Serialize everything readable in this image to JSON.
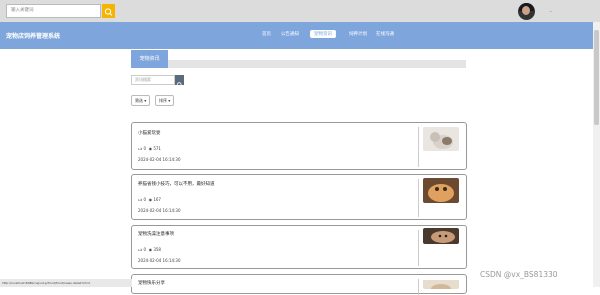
{
  "topbar": {
    "search_placeholder": "输入关键词"
  },
  "navbar": {
    "brand": "宠物店饲养管理系统",
    "items": [
      {
        "label": "首页"
      },
      {
        "label": "公告通知"
      },
      {
        "label": "宠物资讯",
        "active": true
      },
      {
        "label": "饲养计划"
      },
      {
        "label": "在线沟通"
      }
    ]
  },
  "main": {
    "tab_label": "宠物资讯",
    "search_placeholder": "资讯搜索",
    "filter_label": "筛选",
    "sort_label": "排序"
  },
  "articles": [
    {
      "title": "小猫爱玩耍",
      "likes": "0",
      "views": "571",
      "date": "2024-02-04 16:14:30",
      "thumb": "cat-white"
    },
    {
      "title": "养猫省钱小技巧，可以不用，最好知道",
      "likes": "0",
      "views": "167",
      "date": "2024-02-04 16:14:30",
      "thumb": "cat-orange"
    },
    {
      "title": "宠物洗澡注意事项",
      "likes": "0",
      "views": "358",
      "date": "2024-02-04 16:14:30",
      "thumb": "cat-tabby"
    },
    {
      "title": "宠物快乐分享",
      "likes": "",
      "views": "",
      "date": "",
      "thumb": "cat-light"
    }
  ],
  "statusbar": "http://localhost:8080/cwjvu1p/front/front/news-detail?id=2",
  "watermark": "CSDN @vx_BS81330",
  "colors": {
    "accent": "#7fa6dc",
    "search_button": "#f5b400"
  }
}
